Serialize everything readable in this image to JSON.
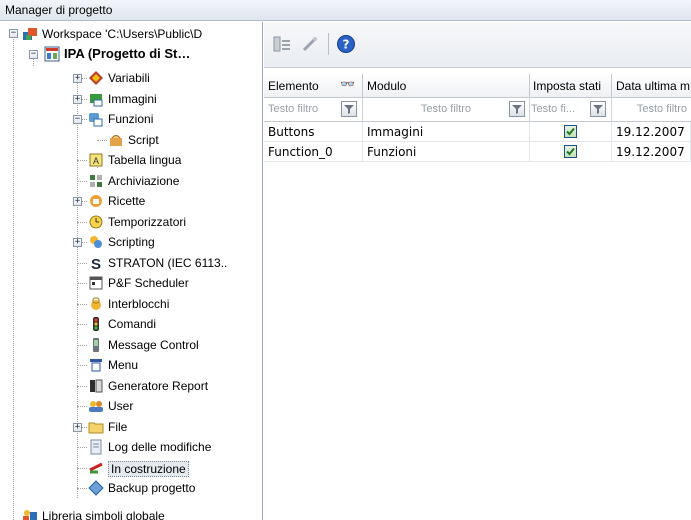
{
  "window": {
    "title": "Manager di progetto"
  },
  "tree": {
    "workspace": "Workspace 'C:\\Users\\Public\\D",
    "project": "IPA (Progetto di St…",
    "items": [
      {
        "label": "Variabili",
        "icon": "variables-icon",
        "expander": "+"
      },
      {
        "label": "Immagini",
        "icon": "screens-icon",
        "expander": "+"
      },
      {
        "label": "Funzioni",
        "icon": "functions-icon",
        "expander": "−"
      },
      {
        "label": "Script",
        "icon": "script-icon",
        "expander": ""
      },
      {
        "label": "Tabella lingua",
        "icon": "language-table-icon",
        "expander": ""
      },
      {
        "label": "Archiviazione",
        "icon": "archive-icon",
        "expander": ""
      },
      {
        "label": "Ricette",
        "icon": "recipes-icon",
        "expander": "+"
      },
      {
        "label": "Temporizzatori",
        "icon": "timer-icon",
        "expander": ""
      },
      {
        "label": "Scripting",
        "icon": "scripting-icon",
        "expander": "+"
      },
      {
        "label": "STRATON (IEC 6113..",
        "icon": "straton-icon",
        "expander": ""
      },
      {
        "label": "P&F Scheduler",
        "icon": "scheduler-icon",
        "expander": ""
      },
      {
        "label": "Interblocchi",
        "icon": "interlock-icon",
        "expander": ""
      },
      {
        "label": "Comandi",
        "icon": "commands-icon",
        "expander": ""
      },
      {
        "label": "Message Control",
        "icon": "message-control-icon",
        "expander": ""
      },
      {
        "label": "Menu",
        "icon": "menu-icon",
        "expander": ""
      },
      {
        "label": "Generatore Report",
        "icon": "report-icon",
        "expander": ""
      },
      {
        "label": "User",
        "icon": "users-icon",
        "expander": ""
      },
      {
        "label": "File",
        "icon": "folder-icon",
        "expander": "+"
      },
      {
        "label": "Log delle modifiche",
        "icon": "change-log-icon",
        "expander": ""
      },
      {
        "label": "In costruzione",
        "icon": "under-construction-icon",
        "expander": ""
      },
      {
        "label": "Backup progetto",
        "icon": "backup-icon",
        "expander": ""
      }
    ],
    "global_library": "Libreria simboli globale"
  },
  "toolbar": {
    "buttons": [
      {
        "icon": "view-icon"
      },
      {
        "icon": "edit-icon"
      },
      {
        "icon": "help-icon"
      }
    ]
  },
  "table": {
    "columns": [
      {
        "label": "Elemento",
        "icon": "binoculars-icon"
      },
      {
        "label": "Modulo"
      },
      {
        "label": "Imposta stati"
      },
      {
        "label": "Data ultima m"
      }
    ],
    "filters": [
      "Testo filtro",
      "Testo filtro",
      "Testo fi...",
      "Testo filtro"
    ],
    "rows": [
      {
        "elemento": "Buttons",
        "modulo": "Immagini",
        "stati": true,
        "data": "19.12.2007"
      },
      {
        "elemento": "Function_0",
        "modulo": "Funzioni",
        "stati": true,
        "data": "19.12.2007"
      }
    ]
  },
  "colors": {
    "header_bg": "#dfe5ee",
    "check_border": "#1c5180",
    "check_mark": "#1f7a1f"
  }
}
